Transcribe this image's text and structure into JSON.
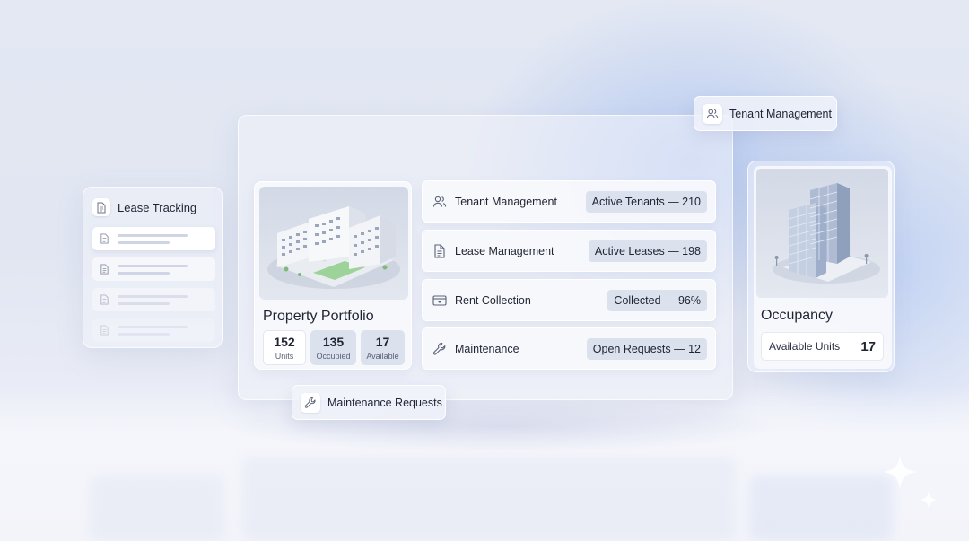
{
  "lease_tracking": {
    "title": "Lease Tracking",
    "icon": "document-icon"
  },
  "property_portfolio": {
    "title": "Property Portfolio",
    "stats": [
      {
        "value": "152",
        "label": "Units"
      },
      {
        "value": "135",
        "label": "Occupied"
      },
      {
        "value": "17",
        "label": "Available"
      }
    ]
  },
  "features": [
    {
      "label": "Tenant Management",
      "badge": "Active Tenants — 210",
      "icon": "users-icon"
    },
    {
      "label": "Lease Management",
      "badge": "Active Leases — 198",
      "icon": "document-icon"
    },
    {
      "label": "Rent Collection",
      "badge": "Collected — 96%",
      "icon": "wallet-icon"
    },
    {
      "label": "Maintenance",
      "badge": "Open Requests — 12",
      "icon": "wrench-icon"
    }
  ],
  "occupancy": {
    "title": "Occupancy",
    "stat_label": "Available Units",
    "stat_value": "17"
  },
  "floating": {
    "tenant_management": "Tenant Management",
    "maintenance_requests": "Maintenance Requests"
  },
  "colors": {
    "background": "#e3e8f3",
    "accent_glow": "#94b4f0",
    "badge_bg": "#dce1ee"
  }
}
